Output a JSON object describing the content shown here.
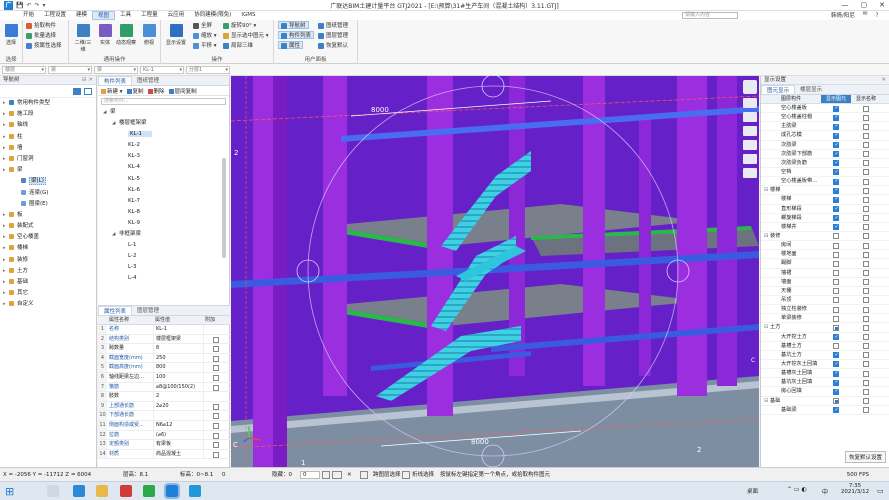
{
  "window": {
    "title": "广联达BIM土建计量平台 GTJ2021 - [E:\\预算\\31#生产车间（混凝土结构）3.11.GTJ]",
    "app_icon": "广",
    "quick_access": [
      "💾",
      "↶",
      "↷",
      "▾"
    ],
    "controls": [
      "—",
      "▢",
      "✕"
    ]
  },
  "menu": {
    "items": [
      "开始",
      "工程设置",
      "建模",
      "视图",
      "工具",
      "工程量",
      "云应用",
      "协同建模(限免)",
      "IGMS"
    ],
    "active_index": 3,
    "search_placeholder": "请输入内容",
    "user": "韩情/阳尼",
    "right_items": [
      "✉",
      "？"
    ]
  },
  "ribbon": {
    "groups": [
      {
        "label": "选择",
        "buttons": [
          {
            "label": "选择",
            "icon": "select-icon",
            "color": "#3a7bd5"
          }
        ],
        "small": []
      },
      {
        "label": "",
        "buttons": [],
        "small": [
          "拾取构件",
          "批量选择",
          "按属性选择"
        ]
      },
      {
        "label": "通用操作",
        "buttons": [
          {
            "label": "二维/三维",
            "icon": "2d3d-icon",
            "color": "#3b82c4"
          },
          {
            "label": "实体",
            "icon": "solid-icon",
            "color": "#7b5cc5"
          },
          {
            "label": "动态观察",
            "icon": "orbit-icon",
            "color": "#2f9e6a"
          },
          {
            "label": "俯视",
            "icon": "topview-icon",
            "color": "#4a8fd8"
          }
        ],
        "small": []
      },
      {
        "label": "操作",
        "buttons": [
          {
            "label": "显示设置",
            "icon": "display-settings-icon",
            "color": "#2f6fc0"
          }
        ],
        "small": [
          "全屏",
          "缩放",
          "平移",
          "旋转90°",
          "显示选中图元",
          "局部三维"
        ]
      },
      {
        "label": "用户面板",
        "buttons": [],
        "small": [
          "导航树",
          "构件列表",
          "属性",
          "图纸管理",
          "图层管理",
          "恢复默认"
        ]
      }
    ],
    "selected_small": [
      "导航树",
      "构件列表",
      "属性"
    ]
  },
  "combobar": {
    "values": [
      "楼层",
      "梁",
      "梁",
      "KL-1",
      "分层1"
    ]
  },
  "nav": {
    "header": "导航树",
    "items": [
      {
        "label": "常用构件类型",
        "indent": 0,
        "color": "#3b82c4"
      },
      {
        "label": "施工段",
        "indent": 0,
        "color": "#e2a23a"
      },
      {
        "label": "轴线",
        "indent": 0,
        "color": "#e2a23a"
      },
      {
        "label": "柱",
        "indent": 0,
        "color": "#e2a23a"
      },
      {
        "label": "墙",
        "indent": 0,
        "color": "#e2a23a"
      },
      {
        "label": "门窗洞",
        "indent": 0,
        "color": "#e2a23a"
      },
      {
        "label": "梁",
        "indent": 0,
        "color": "#e2a23a"
      },
      {
        "label": "梁(L)",
        "indent": 2,
        "color": "#5a7fc0",
        "selected": true
      },
      {
        "label": "连梁(G)",
        "indent": 2,
        "color": "#6aa0d8"
      },
      {
        "label": "圈梁(E)",
        "indent": 2,
        "color": "#6aa0d8"
      },
      {
        "label": "板",
        "indent": 0,
        "color": "#e2a23a"
      },
      {
        "label": "装配式",
        "indent": 0,
        "color": "#e2a23a"
      },
      {
        "label": "空心楼盖",
        "indent": 0,
        "color": "#e2a23a"
      },
      {
        "label": "楼梯",
        "indent": 0,
        "color": "#e2a23a"
      },
      {
        "label": "装修",
        "indent": 0,
        "color": "#e2a23a"
      },
      {
        "label": "土方",
        "indent": 0,
        "color": "#e2a23a"
      },
      {
        "label": "基础",
        "indent": 0,
        "color": "#e2a23a"
      },
      {
        "label": "其它",
        "indent": 0,
        "color": "#e2a23a"
      },
      {
        "label": "自定义",
        "indent": 0,
        "color": "#e2a23a"
      }
    ]
  },
  "components": {
    "tabs": [
      "构件列表",
      "图纸管理"
    ],
    "toolbar": [
      "新建",
      "复制",
      "删除",
      "层间复制"
    ],
    "search_placeholder": "搜索构件...",
    "tree": [
      {
        "label": "梁",
        "indent": 0,
        "arrow": "◢"
      },
      {
        "label": "楼层框架梁",
        "indent": 1,
        "arrow": "◢"
      },
      {
        "label": "KL-1",
        "indent": 2,
        "selected": true
      },
      {
        "label": "KL-2",
        "indent": 2
      },
      {
        "label": "KL-3",
        "indent": 2
      },
      {
        "label": "KL-4",
        "indent": 2
      },
      {
        "label": "KL-5",
        "indent": 2
      },
      {
        "label": "KL-6",
        "indent": 2
      },
      {
        "label": "KL-7",
        "indent": 2
      },
      {
        "label": "KL-8",
        "indent": 2
      },
      {
        "label": "KL-9",
        "indent": 2
      },
      {
        "label": "非框架梁",
        "indent": 1,
        "arrow": "◢"
      },
      {
        "label": "L-1",
        "indent": 2
      },
      {
        "label": "L-2",
        "indent": 2
      },
      {
        "label": "L-3",
        "indent": 2
      },
      {
        "label": "L-4",
        "indent": 2
      }
    ]
  },
  "properties": {
    "tabs": [
      "属性列表",
      "图层管理"
    ],
    "columns": [
      "属性名称",
      "属性值",
      "附加"
    ],
    "rows": [
      {
        "n": "1",
        "k": "名称",
        "v": "KL-1",
        "blue": true,
        "cb": false
      },
      {
        "n": "2",
        "k": "结构类别",
        "v": "楼层框架梁",
        "blue": true,
        "cb": true
      },
      {
        "n": "3",
        "k": "跨数量",
        "v": "8",
        "blue": false,
        "cb": true
      },
      {
        "n": "4",
        "k": "截面宽度(mm)",
        "v": "250",
        "blue": true,
        "cb": true
      },
      {
        "n": "5",
        "k": "截面高度(mm)",
        "v": "800",
        "blue": true,
        "cb": true
      },
      {
        "n": "6",
        "k": "轴线距梁左边...",
        "v": "100",
        "blue": false,
        "cb": true
      },
      {
        "n": "7",
        "k": "箍筋",
        "v": "⌀8@100/150(2)",
        "blue": true,
        "cb": true
      },
      {
        "n": "8",
        "k": "肢数",
        "v": "2",
        "blue": false,
        "cb": false
      },
      {
        "n": "9",
        "k": "上部通长筋",
        "v": "2⌀20",
        "blue": true,
        "cb": true
      },
      {
        "n": "10",
        "k": "下部通长筋",
        "v": "",
        "blue": true,
        "cb": true
      },
      {
        "n": "11",
        "k": "侧面构造或受...",
        "v": "N6⌀12",
        "blue": true,
        "cb": true
      },
      {
        "n": "12",
        "k": "拉筋",
        "v": "(⌀6)",
        "blue": true,
        "cb": true
      },
      {
        "n": "13",
        "k": "定额类别",
        "v": "有梁板",
        "blue": true,
        "cb": true
      },
      {
        "n": "14",
        "k": "材质",
        "v": "商品混凝土",
        "blue": true,
        "cb": true
      }
    ]
  },
  "viewport": {
    "dim_top": "8000",
    "dim_bottom": "8000",
    "grid_labels": [
      "2",
      "C",
      "1",
      "2",
      "C"
    ]
  },
  "display": {
    "header": "显示设置",
    "tabs": [
      "图元显示",
      "楼层显示"
    ],
    "columns": [
      "图层构件",
      "显示图元",
      "显示名称"
    ],
    "rows": [
      {
        "name": "空心楼盖板",
        "indent": 2,
        "c1": "on",
        "c2": "off"
      },
      {
        "name": "空心楼盖柱帽",
        "indent": 2,
        "c1": "on",
        "c2": "off"
      },
      {
        "name": "主肋梁",
        "indent": 2,
        "c1": "on",
        "c2": "off"
      },
      {
        "name": "成孔芯模",
        "indent": 2,
        "c1": "on",
        "c2": "off"
      },
      {
        "name": "次肋梁",
        "indent": 2,
        "c1": "on",
        "c2": "off"
      },
      {
        "name": "次肋梁下部筋",
        "indent": 2,
        "c1": "on",
        "c2": "off"
      },
      {
        "name": "次肋梁负筋",
        "indent": 2,
        "c1": "on",
        "c2": "off"
      },
      {
        "name": "空档",
        "indent": 2,
        "c1": "on",
        "c2": "off"
      },
      {
        "name": "空心楼盖板带...",
        "indent": 2,
        "c1": "on",
        "c2": "off"
      },
      {
        "name": "楼梯",
        "indent": 0,
        "c1": "on",
        "c2": "off",
        "group": true
      },
      {
        "name": "楼梯",
        "indent": 2,
        "c1": "on",
        "c2": "off"
      },
      {
        "name": "直形梯段",
        "indent": 2,
        "c1": "on",
        "c2": "off"
      },
      {
        "name": "螺旋梯段",
        "indent": 2,
        "c1": "on",
        "c2": "off"
      },
      {
        "name": "楼梯井",
        "indent": 2,
        "c1": "on",
        "c2": "off"
      },
      {
        "name": "装修",
        "indent": 0,
        "c1": "off",
        "c2": "off",
        "group": true
      },
      {
        "name": "房间",
        "indent": 2,
        "c1": "off",
        "c2": "off"
      },
      {
        "name": "楼地面",
        "indent": 2,
        "c1": "off",
        "c2": "off"
      },
      {
        "name": "踢脚",
        "indent": 2,
        "c1": "off",
        "c2": "off"
      },
      {
        "name": "墙裙",
        "indent": 2,
        "c1": "off",
        "c2": "off"
      },
      {
        "name": "墙面",
        "indent": 2,
        "c1": "off",
        "c2": "off"
      },
      {
        "name": "天棚",
        "indent": 2,
        "c1": "off",
        "c2": "off"
      },
      {
        "name": "吊顶",
        "indent": 2,
        "c1": "off",
        "c2": "off"
      },
      {
        "name": "独立柱装修",
        "indent": 2,
        "c1": "off",
        "c2": "off"
      },
      {
        "name": "单梁装修",
        "indent": 2,
        "c1": "off",
        "c2": "off"
      },
      {
        "name": "土方",
        "indent": 0,
        "c1": "part",
        "c2": "off",
        "group": true
      },
      {
        "name": "大开挖土方",
        "indent": 2,
        "c1": "on",
        "c2": "off"
      },
      {
        "name": "基槽土方",
        "indent": 2,
        "c1": "off",
        "c2": "off"
      },
      {
        "name": "基坑土方",
        "indent": 2,
        "c1": "on",
        "c2": "off"
      },
      {
        "name": "大开挖灰土回填",
        "indent": 2,
        "c1": "on",
        "c2": "off"
      },
      {
        "name": "基槽灰土回填",
        "indent": 2,
        "c1": "on",
        "c2": "off"
      },
      {
        "name": "基坑灰土回填",
        "indent": 2,
        "c1": "on",
        "c2": "off"
      },
      {
        "name": "房心回填",
        "indent": 2,
        "c1": "on",
        "c2": "off"
      },
      {
        "name": "基础",
        "indent": 0,
        "c1": "part",
        "c2": "off",
        "group": true
      },
      {
        "name": "基础梁",
        "indent": 2,
        "c1": "on",
        "c2": "off"
      }
    ],
    "footer_button": "恢复默认设置"
  },
  "status": {
    "coords": "X = -2056 Y = -11712 Z = 6004",
    "layer_height": "层高：8.1",
    "elevation": "标高：0~8.1",
    "hidden": "隐藏：0",
    "value": "0",
    "zero": "0",
    "cross_select": "跨图层选择",
    "fold_select": "折线选择",
    "hint": "按鼠标左键指定第一个角点，或拾取构件图元",
    "fps": "500 FPS"
  },
  "taskbar": {
    "desktop": "桌面",
    "time": "7:35",
    "date": "2021/3/12",
    "lang": "中"
  }
}
